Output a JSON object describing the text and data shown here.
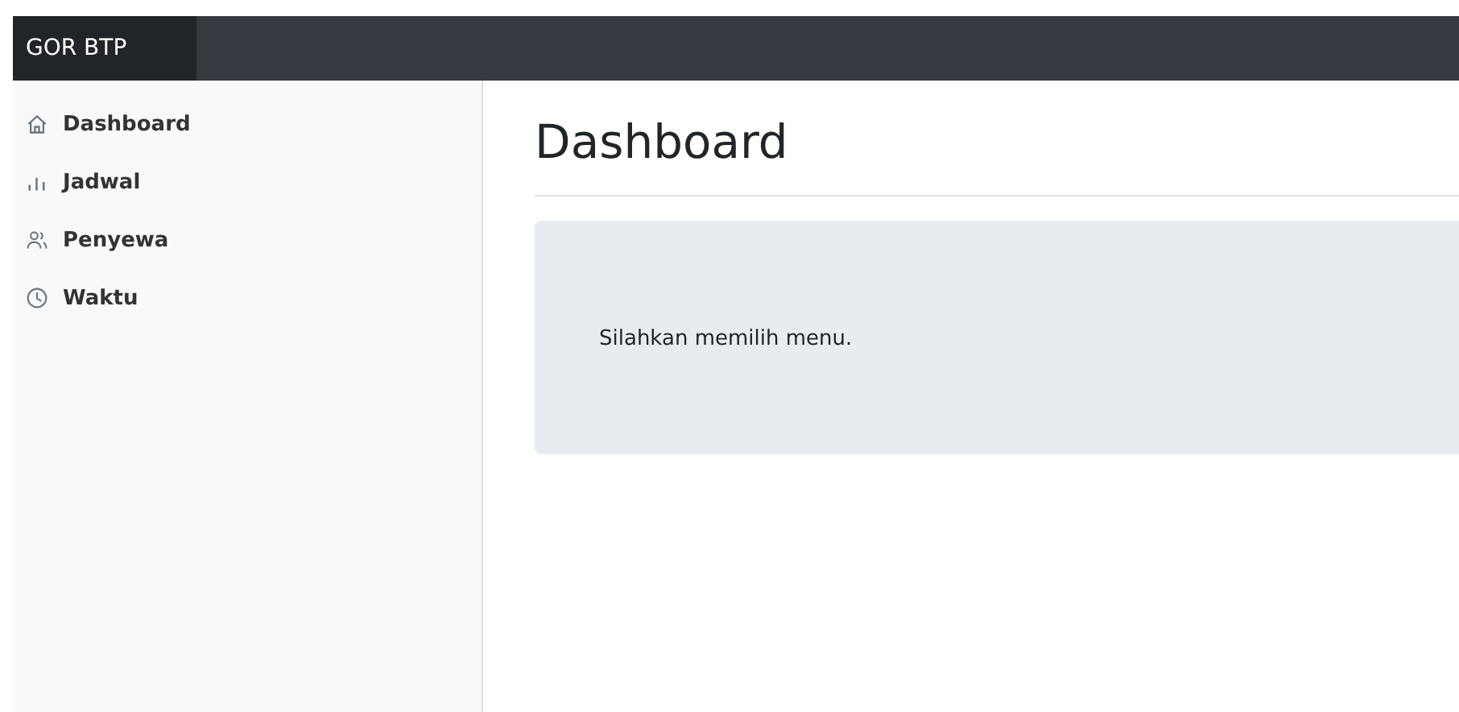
{
  "navbar": {
    "brand": "GOR BTP"
  },
  "sidebar": {
    "items": [
      {
        "label": "Dashboard",
        "kind": "home"
      },
      {
        "label": "Jadwal",
        "kind": "chart"
      },
      {
        "label": "Penyewa",
        "kind": "users"
      },
      {
        "label": "Waktu",
        "kind": "clock"
      }
    ]
  },
  "main": {
    "title": "Dashboard",
    "message": "Silahkan memilih menu."
  }
}
